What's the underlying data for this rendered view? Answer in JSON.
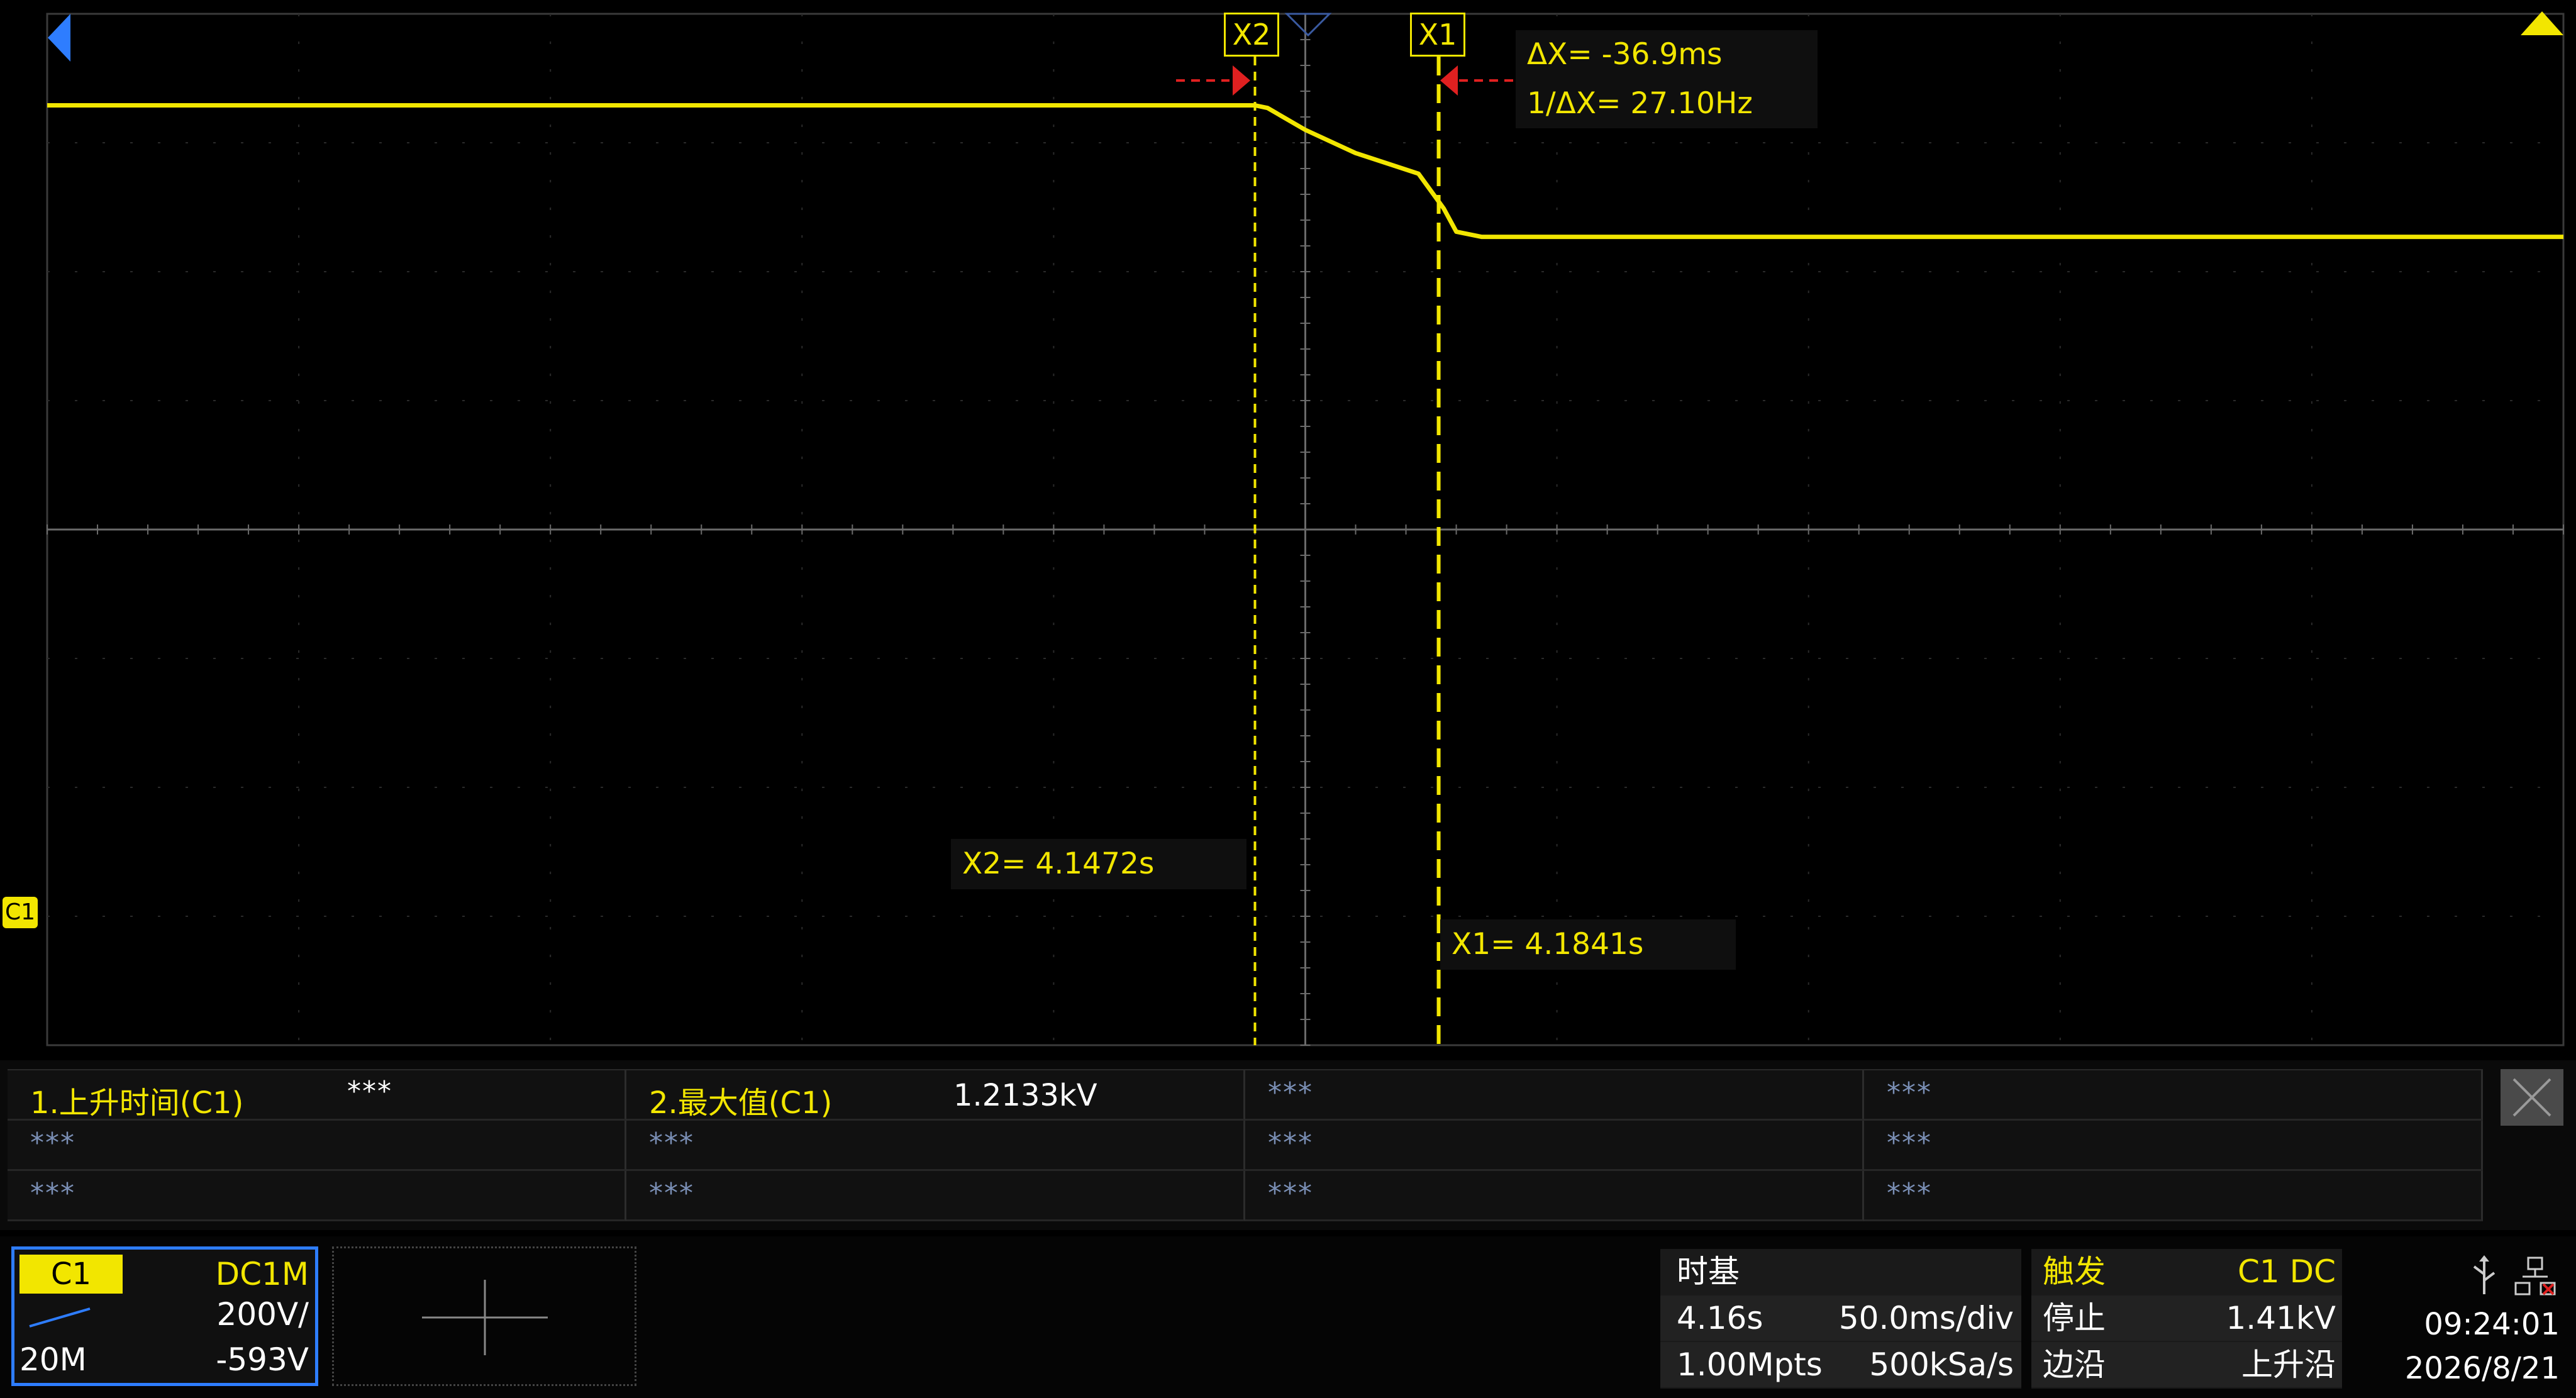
{
  "cursors": {
    "x2_tag": "X2",
    "x1_tag": "X1",
    "delta_x": "ΔX= -36.9ms",
    "inv_delta_x": "1/ΔX= 27.10Hz",
    "x2_readout": "X2= 4.1472s",
    "x1_readout": "X1= 4.1841s"
  },
  "channel_marker": "C1",
  "measurements": {
    "rows": [
      [
        {
          "label": "1.上升时间(C1)",
          "value": "***"
        },
        {
          "label": "2.最大值(C1)",
          "value": "1.2133kV"
        },
        {
          "stars": "***"
        },
        {
          "stars": "***"
        }
      ],
      [
        {
          "stars": "***"
        },
        {
          "stars": "***"
        },
        {
          "stars": "***"
        },
        {
          "stars": "***"
        }
      ],
      [
        {
          "stars": "***"
        },
        {
          "stars": "***"
        },
        {
          "stars": "***"
        },
        {
          "stars": "***"
        }
      ]
    ]
  },
  "channel": {
    "name": "C1",
    "coupling": "DC1M",
    "scale": "200V/",
    "bandwidth": "20M",
    "offset": "-593V"
  },
  "timebase": {
    "title": "时基",
    "delay": "4.16s",
    "scale": "50.0ms/div",
    "memory": "1.00Mpts",
    "sample_rate": "500kSa/s"
  },
  "trigger": {
    "title": "触发",
    "source": "C1 DC",
    "state": "停止",
    "level": "1.41kV",
    "mode": "边沿",
    "slope": "上升沿"
  },
  "clock": {
    "time": "09:24:01",
    "date": "2026/8/21"
  },
  "colors": {
    "trace": "#f2e600",
    "channel_highlight": "#2e7dff",
    "marker_red": "#e02020"
  },
  "chart_data": {
    "type": "line",
    "x_divisions": 10,
    "y_divisions": 8,
    "series": [
      {
        "x_div": [
          0.0,
          4.8,
          4.85,
          5.0,
          5.2,
          5.45,
          5.55,
          5.6,
          5.7,
          7.6,
          10.0
        ],
        "y_div": [
          3.05,
          3.05,
          3.03,
          2.86,
          2.68,
          2.52,
          2.25,
          2.07,
          2.03,
          2.03,
          2.03
        ]
      }
    ],
    "cursors": {
      "x2_div": 4.8,
      "x1_div": 5.53
    }
  }
}
